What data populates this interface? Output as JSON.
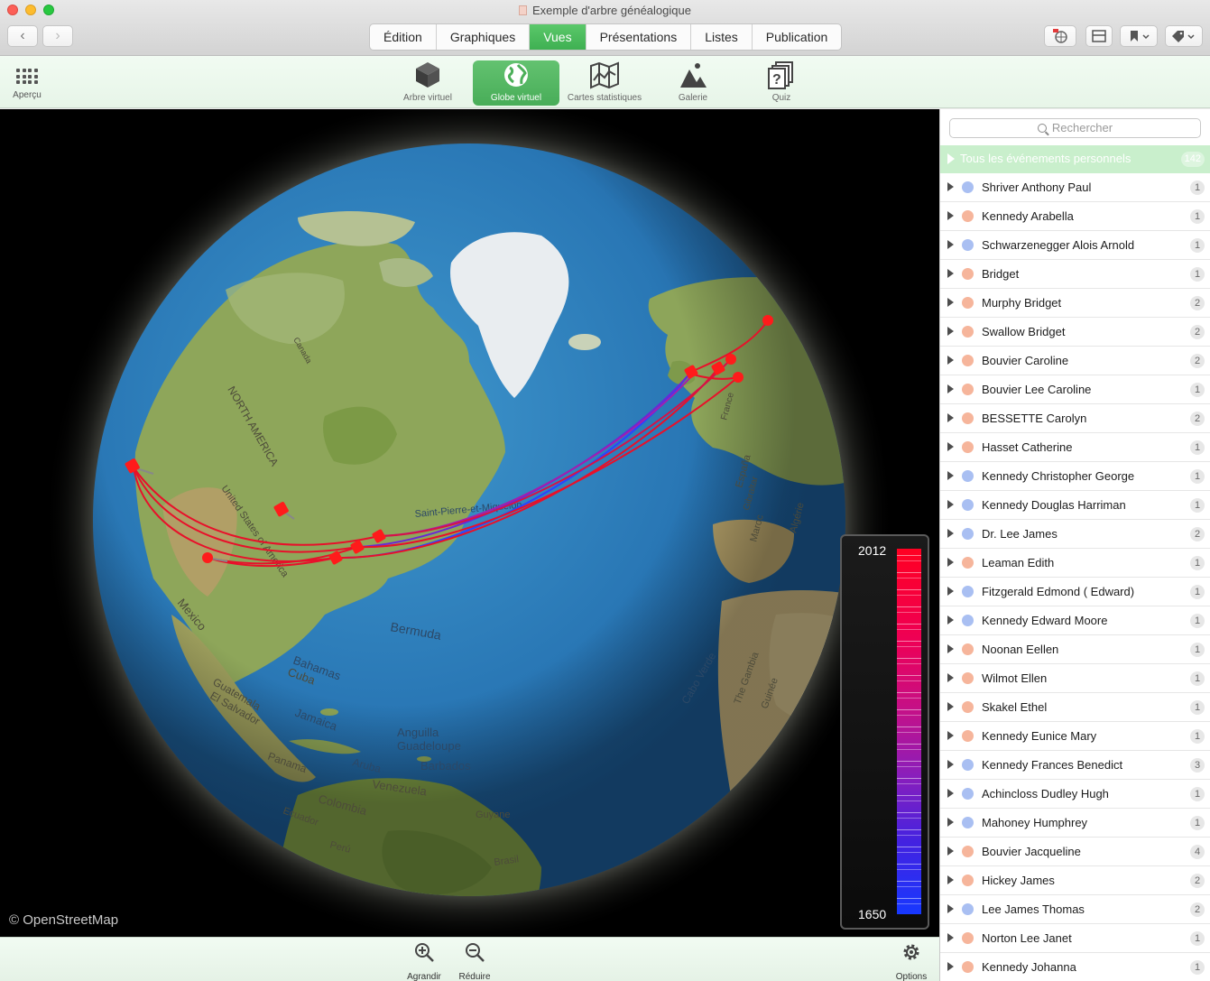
{
  "window": {
    "title": "Exemple d'arbre généalogique"
  },
  "nav": {
    "back": "‹",
    "forward": "›"
  },
  "tabs": [
    "Édition",
    "Graphiques",
    "Vues",
    "Présentations",
    "Listes",
    "Publication"
  ],
  "tabs_active": "Vues",
  "views": {
    "apercu": "Aperçu",
    "items": [
      {
        "label": "Arbre virtuel",
        "icon": "cube-icon"
      },
      {
        "label": "Globe virtuel",
        "icon": "globe-icon",
        "active": true
      },
      {
        "label": "Cartes statistiques",
        "icon": "map-icon"
      },
      {
        "label": "Galerie",
        "icon": "gallery-icon"
      },
      {
        "label": "Quiz",
        "icon": "quiz-icon"
      }
    ]
  },
  "map": {
    "attribution": "© OpenStreetMap",
    "labels": {
      "north_america": "NORTH AMERICA",
      "us": "United States of America",
      "canada": "Canada",
      "mexico": "Mexico",
      "bermuda": "Bermuda",
      "bahamas": "Bahamas",
      "cuba": "Cuba",
      "jamaica": "Jamaica",
      "guatemala": "Guatemala",
      "el_salvador": "El Salvador",
      "panama": "Panama",
      "aruba": "Aruba",
      "venezuela": "Venezuela",
      "colombia": "Colombia",
      "ecuador": "Ecuador",
      "peru": "Perú",
      "guyane": "Guyane",
      "brasil": "Brasil",
      "anguilla": "Anguilla",
      "guadeloupe": "Guadeloupe",
      "barbados": "Barbados",
      "spm": "Saint-Pierre-et-Miquelon",
      "cabo_verde": "Cabo Verde",
      "gambia": "The Gambia",
      "guinea": "Guinée",
      "espana": "España",
      "france": "France",
      "maroc": "Maroc",
      "algerie": "Algérie",
      "gibraltar": "Gibraltar"
    }
  },
  "timeline": {
    "top": "2012",
    "bottom": "1650"
  },
  "bottom": {
    "zoom_in": "Agrandir",
    "zoom_out": "Réduire",
    "options": "Options"
  },
  "sidebar": {
    "search_placeholder": "Rechercher",
    "all_events": {
      "label": "Tous les événements personnels",
      "count": "142"
    },
    "people": [
      {
        "name": "Shriver Anthony Paul",
        "sex": "m",
        "count": "1"
      },
      {
        "name": "Kennedy Arabella",
        "sex": "f",
        "count": "1"
      },
      {
        "name": "Schwarzenegger Alois Arnold",
        "sex": "m",
        "count": "1"
      },
      {
        "name": "Bridget",
        "sex": "f",
        "count": "1"
      },
      {
        "name": "Murphy Bridget",
        "sex": "f",
        "count": "2"
      },
      {
        "name": "Swallow Bridget",
        "sex": "f",
        "count": "2"
      },
      {
        "name": "Bouvier Caroline",
        "sex": "f",
        "count": "2"
      },
      {
        "name": "Bouvier Lee Caroline",
        "sex": "f",
        "count": "1"
      },
      {
        "name": "BESSETTE Carolyn",
        "sex": "f",
        "count": "2"
      },
      {
        "name": "Hasset Catherine",
        "sex": "f",
        "count": "1"
      },
      {
        "name": "Kennedy Christopher George",
        "sex": "m",
        "count": "1"
      },
      {
        "name": "Kennedy Douglas Harriman",
        "sex": "m",
        "count": "1"
      },
      {
        "name": "Dr. Lee James",
        "sex": "m",
        "count": "2"
      },
      {
        "name": "Leaman Edith",
        "sex": "f",
        "count": "1"
      },
      {
        "name": "Fitzgerald Edmond ( Edward)",
        "sex": "m",
        "count": "1"
      },
      {
        "name": "Kennedy Edward Moore",
        "sex": "m",
        "count": "1"
      },
      {
        "name": "Noonan Eellen",
        "sex": "f",
        "count": "1"
      },
      {
        "name": "Wilmot Ellen",
        "sex": "f",
        "count": "1"
      },
      {
        "name": "Skakel Ethel",
        "sex": "f",
        "count": "1"
      },
      {
        "name": "Kennedy Eunice Mary",
        "sex": "f",
        "count": "1"
      },
      {
        "name": "Kennedy Frances Benedict",
        "sex": "m",
        "count": "3"
      },
      {
        "name": "Achincloss Dudley Hugh",
        "sex": "m",
        "count": "1"
      },
      {
        "name": "Mahoney Humphrey",
        "sex": "m",
        "count": "1"
      },
      {
        "name": "Bouvier Jacqueline",
        "sex": "f",
        "count": "4"
      },
      {
        "name": "Hickey James",
        "sex": "f",
        "count": "2"
      },
      {
        "name": "Lee James Thomas",
        "sex": "m",
        "count": "2"
      },
      {
        "name": "Norton Lee Janet",
        "sex": "f",
        "count": "1"
      },
      {
        "name": "Kennedy Johanna",
        "sex": "f",
        "count": "1"
      }
    ]
  }
}
